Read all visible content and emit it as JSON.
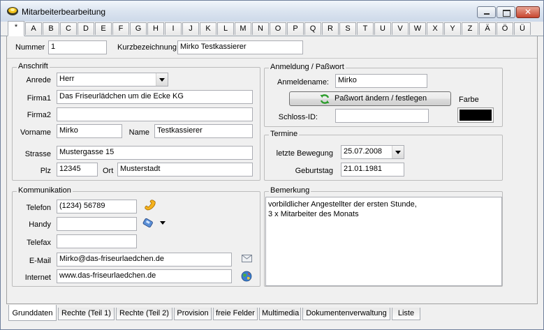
{
  "window": {
    "title": "Mitarbeiterbearbeitung"
  },
  "letters": [
    "*",
    "A",
    "B",
    "C",
    "D",
    "E",
    "F",
    "G",
    "H",
    "I",
    "J",
    "K",
    "L",
    "M",
    "N",
    "O",
    "P",
    "Q",
    "R",
    "S",
    "T",
    "U",
    "V",
    "W",
    "X",
    "Y",
    "Z",
    "Ä",
    "Ö",
    "Ü"
  ],
  "header": {
    "nummer_label": "Nummer",
    "nummer_value": "1",
    "kurz_label": "Kurzbezeichnung",
    "kurz_value": "Mirko Testkassierer"
  },
  "anschrift": {
    "group_label": "Anschrift",
    "anrede_label": "Anrede",
    "anrede_value": "Herr",
    "firma1_label": "Firma1",
    "firma1_value": "Das Friseurlädchen um die Ecke KG",
    "firma2_label": "Firma2",
    "firma2_value": "",
    "vorname_label": "Vorname",
    "vorname_value": "Mirko",
    "name_label": "Name",
    "name_value": "Testkassierer",
    "strasse_label": "Strasse",
    "strasse_value": "Mustergasse 15",
    "plz_label": "Plz",
    "plz_value": "12345",
    "ort_label": "Ort",
    "ort_value": "Musterstadt"
  },
  "kommunikation": {
    "group_label": "Kommunikation",
    "telefon_label": "Telefon",
    "telefon_value": "(1234) 56789",
    "handy_label": "Handy",
    "handy_value": "",
    "telefax_label": "Telefax",
    "telefax_value": "",
    "email_label": "E-Mail",
    "email_value": "Mirko@das-friseurlaedchen.de",
    "internet_label": "Internet",
    "internet_value": "www.das-friseurlaedchen.de"
  },
  "anmeldung": {
    "group_label": "Anmeldung / Paßwort",
    "anmeldename_label": "Anmeldename:",
    "anmeldename_value": "Mirko",
    "passwort_button": "Paßwort ändern / festlegen",
    "farbe_label": "Farbe",
    "farbe_color": "#000000",
    "schloss_label": "Schloss-ID:",
    "schloss_value": ""
  },
  "termine": {
    "group_label": "Termine",
    "bewegung_label": "letzte Bewegung",
    "bewegung_value": "25.07.2008",
    "geburtstag_label": "Geburtstag",
    "geburtstag_value": "21.01.1981"
  },
  "bemerkung": {
    "group_label": "Bemerkung",
    "lines": [
      "vorbildlicher Angestellter der ersten Stunde,",
      "3 x Mitarbeiter des Monats"
    ]
  },
  "bottom_tabs": [
    "Grunddaten",
    "Rechte (Teil 1)",
    "Rechte (Teil 2)",
    "Provision",
    "freie Felder",
    "Multimedia",
    "Dokumentenverwaltung",
    "Liste"
  ]
}
